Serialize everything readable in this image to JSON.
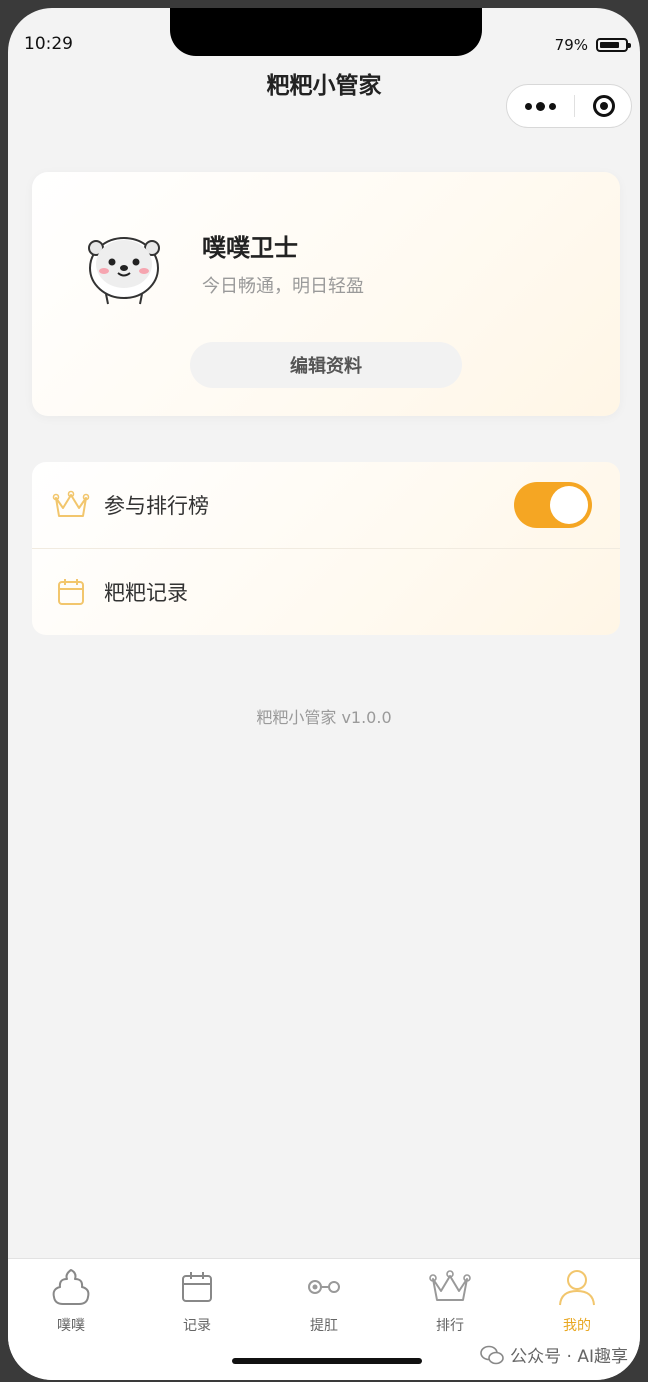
{
  "status_bar": {
    "time": "10:29",
    "battery": "79%",
    "battery_level": 0.79
  },
  "nav": {
    "title": "粑粑小管家",
    "menu_icon": "more-dots-icon",
    "close_icon": "target-icon"
  },
  "profile": {
    "avatar_icon": "otter-avatar",
    "name": "噗噗卫士",
    "motto": "今日畅通，明日轻盈",
    "edit_label": "编辑资料"
  },
  "settings": {
    "rows": [
      {
        "icon": "crown-icon",
        "label": "参与排行榜",
        "toggle_on": true
      },
      {
        "icon": "calendar-icon",
        "label": "粑粑记录"
      }
    ]
  },
  "version_text": "粑粑小管家 v1.0.0",
  "tabbar": {
    "tabs": [
      {
        "label": "噗噗",
        "icon": "poop-icon",
        "active": false
      },
      {
        "label": "记录",
        "icon": "calendar-icon",
        "active": false
      },
      {
        "label": "提肛",
        "icon": "exercise-icon",
        "active": false
      },
      {
        "label": "排行",
        "icon": "crown-icon",
        "active": false
      },
      {
        "label": "我的",
        "icon": "user-icon",
        "active": true
      }
    ],
    "accent": "#e8a723"
  },
  "watermark": "公众号 · AI趣享",
  "colors": {
    "accent": "#f5a623",
    "background": "#f3f3f3"
  }
}
